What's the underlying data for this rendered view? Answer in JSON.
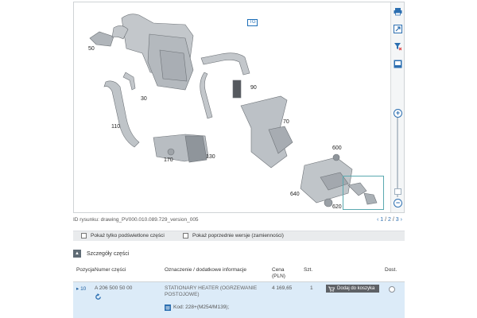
{
  "viewer": {
    "page_value": "228",
    "diagram_ref": "TG",
    "labels": {
      "l50": "50",
      "l30": "30",
      "l90": "90",
      "l110": "110",
      "l70": "70",
      "l600": "600",
      "l170": "170",
      "l130": "130",
      "l640": "640",
      "l620": "620"
    },
    "icons": [
      "print-icon",
      "export-icon",
      "filter-icon",
      "fullscreen-icon",
      "zoom-in-icon",
      "zoom-out-icon"
    ]
  },
  "drawing": {
    "id_text": "ID rysunku: drawing_PV000.010.089.729_version_005",
    "pager": {
      "prev": "‹",
      "current": "1",
      "sep1": "/",
      "p2": "2",
      "sep2": "/",
      "p3": "3",
      "next": "›"
    }
  },
  "options": {
    "show_highlighted": "Pokaż tylko podświetlone części",
    "show_previous": "Pokaż poprzednie wersje (zamienności)"
  },
  "details": {
    "title": "Szczegóły części",
    "collapse_symbol": "▲",
    "columns": {
      "position": "Pozycja",
      "part_number": "Numer części",
      "designation": "Oznaczenie / dodatkowe informacje",
      "price": "Cena",
      "price_unit": "(PLN)",
      "qty": "Szt.",
      "availability": "Dost."
    },
    "rows": [
      {
        "position": "▸ 10",
        "part_number": "A 206 500 50 00",
        "designation": "STATIONARY HEATER (OGRZEWANIE POSTOJOWE)",
        "code": "Kod: 228+(M254/M139);",
        "price": "4 169,65",
        "qty": "1",
        "add_button": "Dodaj do koszyka"
      }
    ]
  },
  "colors": {
    "accent": "#2c6fb1",
    "row_highlight": "#dcebf8",
    "button": "#5e6166"
  }
}
